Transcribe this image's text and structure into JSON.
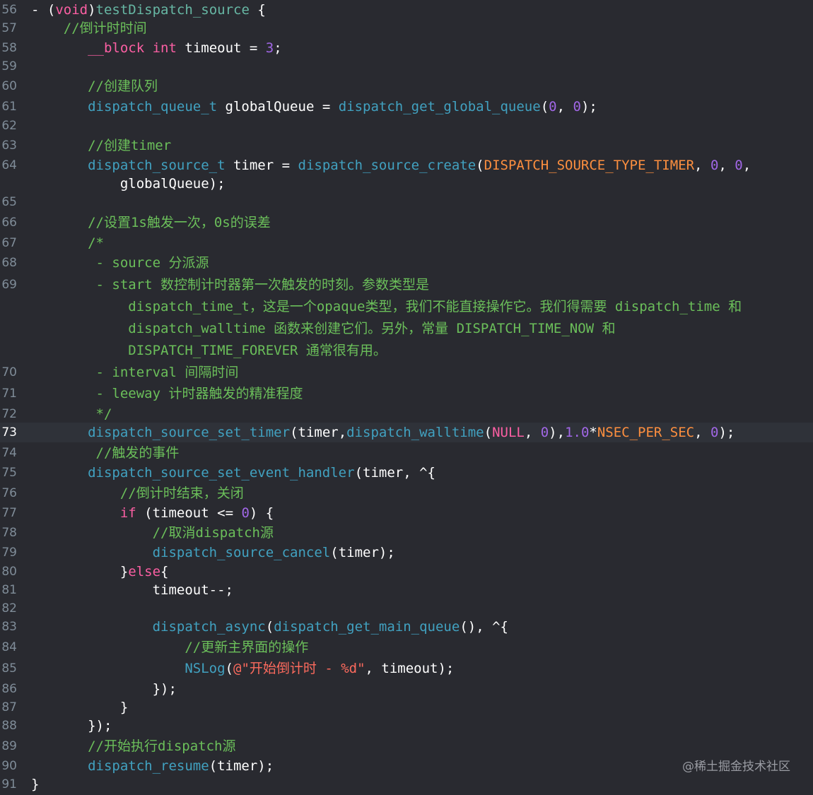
{
  "colors": {
    "background": "#292a30",
    "keyword": "#fc5fa3",
    "function": "#41a1c0",
    "comment": "#6bbf5a",
    "string": "#fc6a5d",
    "number": "#a167e6",
    "macro": "#fd8f3f",
    "plain": "#ffffff"
  },
  "watermark": "@稀土掘金技术社区",
  "current_line": "73",
  "lines": [
    {
      "n": "56",
      "segs": [
        [
          "pl",
          "- ("
        ],
        [
          "kw",
          "void"
        ],
        [
          "pl",
          ")"
        ],
        [
          "fn",
          "testDispatch_source"
        ],
        [
          "pl",
          " {"
        ]
      ]
    },
    {
      "n": "57",
      "segs": [
        [
          "cm",
          "    //倒计时时间"
        ]
      ]
    },
    {
      "n": "58",
      "segs": [
        [
          "pl",
          "       "
        ],
        [
          "kw",
          "__block"
        ],
        [
          "pl",
          " "
        ],
        [
          "kw",
          "int"
        ],
        [
          "pl",
          " timeout = "
        ],
        [
          "nm2",
          "3"
        ],
        [
          "pl",
          ";"
        ]
      ]
    },
    {
      "n": "59",
      "segs": []
    },
    {
      "n": "60",
      "segs": [
        [
          "cm",
          "       //创建队列"
        ]
      ]
    },
    {
      "n": "61",
      "segs": [
        [
          "pl",
          "       "
        ],
        [
          "ap",
          "dispatch_queue_t"
        ],
        [
          "pl",
          " globalQueue = "
        ],
        [
          "ap",
          "dispatch_get_global_queue"
        ],
        [
          "pl",
          "("
        ],
        [
          "nm2",
          "0"
        ],
        [
          "pl",
          ", "
        ],
        [
          "nm2",
          "0"
        ],
        [
          "pl",
          ");"
        ]
      ]
    },
    {
      "n": "62",
      "segs": []
    },
    {
      "n": "63",
      "segs": [
        [
          "cm",
          "       //创建timer"
        ]
      ]
    },
    {
      "n": "64",
      "segs": [
        [
          "pl",
          "       "
        ],
        [
          "ap",
          "dispatch_source_t"
        ],
        [
          "pl",
          " timer = "
        ],
        [
          "ap",
          "dispatch_source_create"
        ],
        [
          "pl",
          "("
        ],
        [
          "mc",
          "DISPATCH_SOURCE_TYPE_TIMER"
        ],
        [
          "pl",
          ", "
        ],
        [
          "nm2",
          "0"
        ],
        [
          "pl",
          ", "
        ],
        [
          "nm2",
          "0"
        ],
        [
          "pl",
          ","
        ]
      ]
    },
    {
      "n": "",
      "segs": [
        [
          "pl",
          "           globalQueue);"
        ]
      ]
    },
    {
      "n": "65",
      "segs": []
    },
    {
      "n": "66",
      "segs": [
        [
          "cm",
          "       //设置1s触发一次，0s的误差"
        ]
      ]
    },
    {
      "n": "67",
      "segs": [
        [
          "cm",
          "       /*"
        ]
      ]
    },
    {
      "n": "68",
      "segs": [
        [
          "cm",
          "        - source 分派源"
        ]
      ]
    },
    {
      "n": "69",
      "segs": [
        [
          "cm",
          "        - start 数控制计时器第一次触发的时刻。参数类型是"
        ]
      ]
    },
    {
      "n": "",
      "segs": [
        [
          "cm",
          "            dispatch_time_t，这是一个opaque类型，我们不能直接操作它。我们得需要 dispatch_time 和"
        ]
      ]
    },
    {
      "n": "",
      "segs": [
        [
          "cm",
          "            dispatch_walltime 函数来创建它们。另外，常量 DISPATCH_TIME_NOW 和"
        ]
      ]
    },
    {
      "n": "",
      "segs": [
        [
          "cm",
          "            DISPATCH_TIME_FOREVER 通常很有用。"
        ]
      ]
    },
    {
      "n": "70",
      "segs": [
        [
          "cm",
          "        - interval 间隔时间"
        ]
      ]
    },
    {
      "n": "71",
      "segs": [
        [
          "cm",
          "        - leeway 计时器触发的精准程度"
        ]
      ]
    },
    {
      "n": "72",
      "segs": [
        [
          "cm",
          "        */"
        ]
      ]
    },
    {
      "n": "73",
      "segs": [
        [
          "pl",
          "       "
        ],
        [
          "ap",
          "dispatch_source_set_timer"
        ],
        [
          "pl",
          "(timer,"
        ],
        [
          "ap",
          "dispatch_walltime"
        ],
        [
          "pl",
          "("
        ],
        [
          "kw",
          "NULL"
        ],
        [
          "pl",
          ", "
        ],
        [
          "nm2",
          "0"
        ],
        [
          "pl",
          "),"
        ],
        [
          "nm2",
          "1.0"
        ],
        [
          "pl",
          "*"
        ],
        [
          "mc",
          "NSEC_PER_SEC"
        ],
        [
          "pl",
          ", "
        ],
        [
          "nm2",
          "0"
        ],
        [
          "pl",
          ");"
        ]
      ]
    },
    {
      "n": "74",
      "segs": [
        [
          "cm",
          "        //触发的事件"
        ]
      ]
    },
    {
      "n": "75",
      "segs": [
        [
          "pl",
          "       "
        ],
        [
          "ap",
          "dispatch_source_set_event_handler"
        ],
        [
          "pl",
          "(timer, ^{"
        ]
      ]
    },
    {
      "n": "76",
      "segs": [
        [
          "cm",
          "           //倒计时结束，关闭"
        ]
      ]
    },
    {
      "n": "77",
      "segs": [
        [
          "pl",
          "           "
        ],
        [
          "kw",
          "if"
        ],
        [
          "pl",
          " (timeout <= "
        ],
        [
          "nm2",
          "0"
        ],
        [
          "pl",
          ") {"
        ]
      ]
    },
    {
      "n": "78",
      "segs": [
        [
          "cm",
          "               //取消dispatch源"
        ]
      ]
    },
    {
      "n": "79",
      "segs": [
        [
          "pl",
          "               "
        ],
        [
          "ap",
          "dispatch_source_cancel"
        ],
        [
          "pl",
          "(timer);"
        ]
      ]
    },
    {
      "n": "80",
      "segs": [
        [
          "pl",
          "           }"
        ],
        [
          "kw",
          "else"
        ],
        [
          "pl",
          "{"
        ]
      ]
    },
    {
      "n": "81",
      "segs": [
        [
          "pl",
          "               timeout--;"
        ]
      ]
    },
    {
      "n": "82",
      "segs": []
    },
    {
      "n": "83",
      "segs": [
        [
          "pl",
          "               "
        ],
        [
          "ap",
          "dispatch_async"
        ],
        [
          "pl",
          "("
        ],
        [
          "ap",
          "dispatch_get_main_queue"
        ],
        [
          "pl",
          "(), ^{"
        ]
      ]
    },
    {
      "n": "84",
      "segs": [
        [
          "cm",
          "                   //更新主界面的操作"
        ]
      ]
    },
    {
      "n": "85",
      "segs": [
        [
          "pl",
          "                   "
        ],
        [
          "ap",
          "NSLog"
        ],
        [
          "pl",
          "("
        ],
        [
          "st",
          "@\"开始倒计时 - %d\""
        ],
        [
          "pl",
          ", timeout);"
        ]
      ]
    },
    {
      "n": "86",
      "segs": [
        [
          "pl",
          "               });"
        ]
      ]
    },
    {
      "n": "87",
      "segs": [
        [
          "pl",
          "           }"
        ]
      ]
    },
    {
      "n": "88",
      "segs": [
        [
          "pl",
          "       });"
        ]
      ]
    },
    {
      "n": "89",
      "segs": [
        [
          "cm",
          "       //开始执行dispatch源"
        ]
      ]
    },
    {
      "n": "90",
      "segs": [
        [
          "pl",
          "       "
        ],
        [
          "ap",
          "dispatch_resume"
        ],
        [
          "pl",
          "(timer);"
        ]
      ]
    },
    {
      "n": "91",
      "segs": [
        [
          "pl",
          "}"
        ]
      ]
    }
  ]
}
